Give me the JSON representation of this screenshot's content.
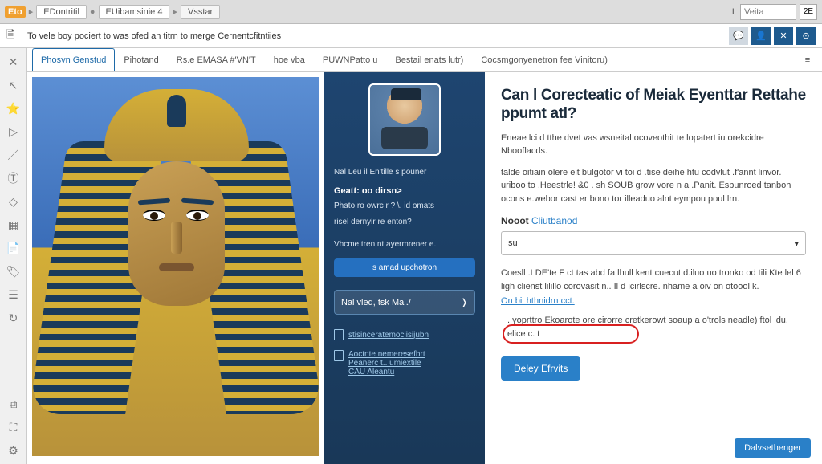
{
  "topbar": {
    "logo": "Eto",
    "tab1": "EDontritil",
    "tab2": "EUibamsinie  4",
    "tab3": "Vsstar",
    "search_symbol": "L",
    "search_placeholder": "Veita",
    "btn_label": "2E"
  },
  "secondbar": {
    "text": "To vele boy pociert to was ofed an titrn to merge Cernentcfitntiies"
  },
  "tabs": [
    {
      "label": "Phosvn Genstud",
      "active": true
    },
    {
      "label": "Pihotand"
    },
    {
      "label": "Rs.e EMASA #'VN'T"
    },
    {
      "label": "hoe vba"
    },
    {
      "label": "PUWNPatto u"
    },
    {
      "label": "Bestail enats lutr)"
    },
    {
      "label": "Cocsmgonyenetron fee Vinitoru)"
    }
  ],
  "mid": {
    "line1": "Nal Leu il En'tille s pouner",
    "greeting": "Geatt: oo dirsn>",
    "sub1": "Phato ro owrc r ? \\. id omats",
    "sub2": "risel dernyir re enton?",
    "sub3": "Vhcme tren nt ayermrener e.",
    "btn1": "s amad upchotron",
    "btn2": "Nal vled, tsk Mal./",
    "link1": "stisinceratemociisijubn",
    "link2a": "Aoctnte nemeresefbrt",
    "link2b": "Peanerc t.. umiextile",
    "link2c": "CAU Aleantu"
  },
  "right": {
    "title": "Can l Corecteatic of Meiak Eyenttar Rettahe ppumt atl?",
    "para1": "Eneae lci d tthe dvet vas wsneital ocoveothit te lopatert iu orekcidre Nbooflacds.",
    "para2": "talde oitiain olere eit bulgotor vi toi d .tise deihe htu codvlut .f'annt linvor. uriboo to .Heestrle! &0 . sh SOUB grow vore n a .Panit. Esbunroed tanboh ocons e.webor cast er bono tor illeaduo alnt eympou poul lrn.",
    "select_label_a": "Nooot ",
    "select_label_b": "Cliutbanod",
    "select_value": "su",
    "para3": "Coesll .LDE'te F ct tas abd fa lhull kent cuecut d.iluo uo tronko od tili Kte lel 6 ligh clienst lilillo corovasit n.. Il   d icirlscre. nhame a oiv on otoool k.",
    "link1": "On bil hthnidrn cct.",
    "bullet": ". yoprttro Ekoarote ore cirorre cretkerowt soaup a o'trols neadle) ftol ldu. elice c. t",
    "primary_btn": "Deley Efrvits",
    "footer_btn": "Dalvsethenger"
  }
}
